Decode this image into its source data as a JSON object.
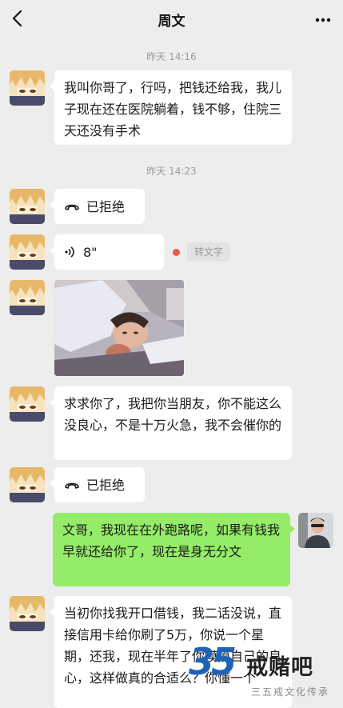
{
  "header": {
    "title": "周文"
  },
  "messages": {
    "time1": "昨天 14:16",
    "text1": "我叫你哥了，行吗，把钱还给我，我儿子现在还在医院躺着，钱不够，住院三天还没有手术",
    "time2": "昨天 14:23",
    "call1": "已拒绝",
    "voice_duration": "8\"",
    "transcribe_label": "转文字",
    "text2": "求求你了，我把你当朋友，你不能这么没良心，不是十万火急，我不会催你的",
    "call2": "已拒绝",
    "reply": "文哥，我现在在外跑路呢，如果有钱我早就还给你了，现在是身无分文",
    "text3": "当初你找我开口借钱，我二话没说，直接信用卡给你刷了5万，你说一个星期，还我，现在半年了你摸摸自己的良心，这样做真的合适么？你懂一个"
  },
  "watermark": {
    "number": "35",
    "brand": "戒赌吧",
    "sub": "三五戒文化传承"
  },
  "colors": {
    "background": "#ededed",
    "bubble_white": "#ffffff",
    "bubble_green": "#95ec69",
    "unread_dot": "#f05a4a"
  },
  "icons": [
    "back-icon",
    "more-icon",
    "phone-declined-icon",
    "voice-icon"
  ]
}
